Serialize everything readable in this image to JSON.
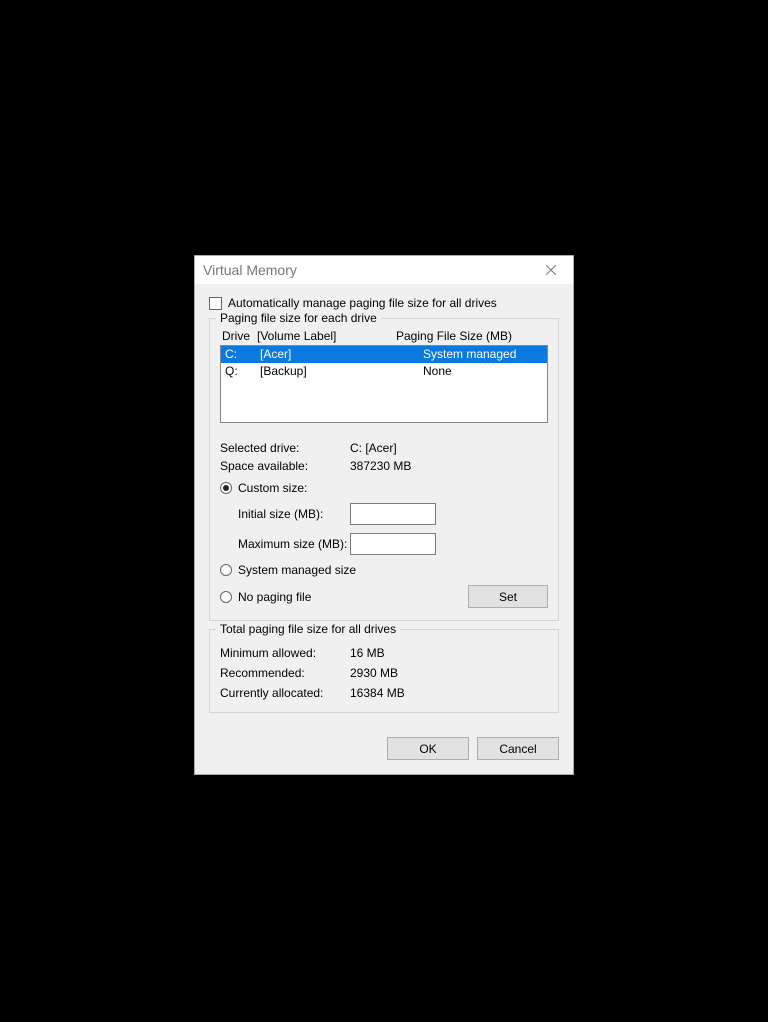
{
  "dialog": {
    "title": "Virtual Memory",
    "auto_manage_label": "Automatically manage paging file size for all drives",
    "auto_manage_checked": false
  },
  "drive_group": {
    "legend": "Paging file size for each drive",
    "header_drive": "Drive",
    "header_label": "[Volume Label]",
    "header_size": "Paging File Size (MB)",
    "rows": [
      {
        "drive": "C:",
        "label": "[Acer]",
        "size": "System managed",
        "selected": true
      },
      {
        "drive": "Q:",
        "label": "[Backup]",
        "size": "None",
        "selected": false
      }
    ],
    "selected_drive_label": "Selected drive:",
    "selected_drive_value": "C:  [Acer]",
    "space_available_label": "Space available:",
    "space_available_value": "387230 MB",
    "radio_custom_label": "Custom size:",
    "initial_size_label": "Initial size (MB):",
    "initial_size_value": "",
    "maximum_size_label": "Maximum size (MB):",
    "maximum_size_value": "",
    "radio_system_label": "System managed size",
    "radio_none_label": "No paging file",
    "radio_selected": "custom",
    "set_button": "Set"
  },
  "totals": {
    "legend": "Total paging file size for all drives",
    "min_label": "Minimum allowed:",
    "min_value": "16 MB",
    "rec_label": "Recommended:",
    "rec_value": "2930 MB",
    "cur_label": "Currently allocated:",
    "cur_value": "16384 MB"
  },
  "footer": {
    "ok": "OK",
    "cancel": "Cancel"
  }
}
